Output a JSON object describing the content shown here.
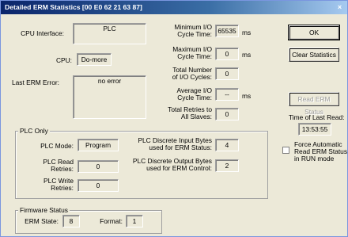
{
  "window": {
    "title": "Detailed ERM Statistics [00 E0 62 21 63 87]",
    "close_glyph": "×"
  },
  "cpu_interface": {
    "label": "CPU Interface:",
    "value": "PLC"
  },
  "cpu": {
    "label": "CPU:",
    "value": "Do-more"
  },
  "last_erm_error": {
    "label": "Last ERM Error:",
    "value": "no error"
  },
  "min_io": {
    "label_1": "Minimum I/O",
    "label_2": "Cycle Time:",
    "value": "65535",
    "unit": "ms"
  },
  "max_io": {
    "label_1": "Maximum I/O",
    "label_2": "Cycle Time:",
    "value": "0",
    "unit": "ms"
  },
  "total_io": {
    "label_1": "Total Number",
    "label_2": "of I/O Cycles:",
    "value": "0"
  },
  "avg_io": {
    "label_1": "Average I/O",
    "label_2": "Cycle Time:",
    "value": "--",
    "unit": "ms"
  },
  "total_retries": {
    "label_1": "Total Retries to",
    "label_2": "All Slaves:",
    "value": "0"
  },
  "buttons": {
    "ok": "OK",
    "clear": "Clear Statistics",
    "read_erm": "Read ERM Status"
  },
  "time_last_read": {
    "label": "Time of Last Read:",
    "value": "13:53:55"
  },
  "force_auto": {
    "line_1": "Force Automatic",
    "line_2": "Read ERM Status",
    "line_3": "in RUN mode"
  },
  "plc_only": {
    "title": "PLC Only",
    "mode_label": "PLC Mode:",
    "mode_value": "Program",
    "read_retries_label_1": "PLC Read",
    "read_retries_label_2": "Retries:",
    "read_retries_value": "0",
    "write_retries_label_1": "PLC Write",
    "write_retries_label_2": "Retries:",
    "write_retries_value": "0",
    "discrete_in_label_1": "PLC Discrete Input Bytes",
    "discrete_in_label_2": "used for ERM Status:",
    "discrete_in_value": "4",
    "discrete_out_label_1": "PLC Discrete Output Bytes",
    "discrete_out_label_2": "used for ERM Control:",
    "discrete_out_value": "2"
  },
  "firmware": {
    "title": "Firmware Status",
    "erm_state_label": "ERM State:",
    "erm_state_value": "8",
    "format_label": "Format:",
    "format_value": "1"
  }
}
